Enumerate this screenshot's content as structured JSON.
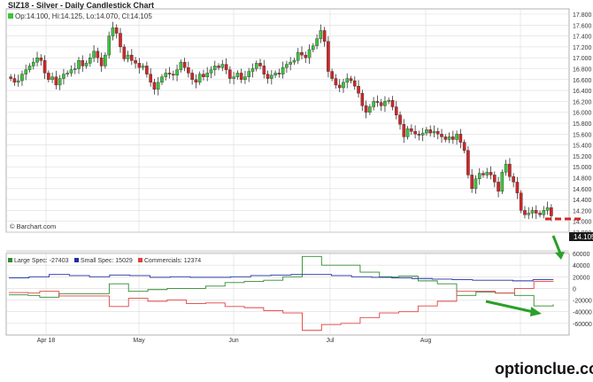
{
  "chart_data": [
    {
      "type": "candlestick",
      "title": "SIZ18 - Silver - Daily Candlestick Chart",
      "ohlc_label": "Op:14.100, Hi:14.125, Lo:14.070, Cl:14.105",
      "source": "© Barchart.com",
      "last_price_label": "14.105",
      "ylim": [
        13.8,
        17.8
      ],
      "y_ticks": [
        "17.800",
        "17.600",
        "17.400",
        "17.200",
        "17.000",
        "16.800",
        "16.600",
        "16.400",
        "16.200",
        "16.000",
        "15.800",
        "15.600",
        "15.400",
        "15.200",
        "15.000",
        "14.800",
        "14.600",
        "14.400",
        "14.200",
        "14.000",
        "13.800"
      ],
      "up_color": "#3cc43c",
      "down_color": "#d42424",
      "closes": [
        16.62,
        16.55,
        16.58,
        16.7,
        16.78,
        16.85,
        16.92,
        17.0,
        16.95,
        16.72,
        16.6,
        16.65,
        16.5,
        16.62,
        16.7,
        16.72,
        16.78,
        16.8,
        16.95,
        16.85,
        16.9,
        17.0,
        17.12,
        17.0,
        16.85,
        17.05,
        17.4,
        17.55,
        17.45,
        17.2,
        16.98,
        17.05,
        16.95,
        16.9,
        16.82,
        16.85,
        16.7,
        16.55,
        16.42,
        16.55,
        16.65,
        16.72,
        16.7,
        16.68,
        16.78,
        16.92,
        16.82,
        16.72,
        16.6,
        16.55,
        16.7,
        16.65,
        16.72,
        16.78,
        16.85,
        16.82,
        16.88,
        16.78,
        16.62,
        16.65,
        16.72,
        16.6,
        16.65,
        16.75,
        16.8,
        16.9,
        16.85,
        16.7,
        16.62,
        16.68,
        16.72,
        16.7,
        16.82,
        16.88,
        16.92,
        16.95,
        17.1,
        17.05,
        17.0,
        17.15,
        17.22,
        17.35,
        17.5,
        17.3,
        16.75,
        16.62,
        16.5,
        16.45,
        16.55,
        16.62,
        16.58,
        16.48,
        16.35,
        16.12,
        16.0,
        16.1,
        16.2,
        16.18,
        16.12,
        16.2,
        16.22,
        16.1,
        15.95,
        15.78,
        15.55,
        15.7,
        15.65,
        15.6,
        15.58,
        15.62,
        15.68,
        15.62,
        15.65,
        15.6,
        15.55,
        15.5,
        15.55,
        15.5,
        15.6,
        15.45,
        15.3,
        14.85,
        14.6,
        14.78,
        14.88,
        14.85,
        14.9,
        14.85,
        14.72,
        14.55,
        14.9,
        15.05,
        14.82,
        14.72,
        14.52,
        14.2,
        14.12,
        14.15,
        14.2,
        14.15,
        14.12,
        14.2,
        14.25,
        14.1
      ],
      "month_labels": [
        "Apr 18",
        "May",
        "Jun",
        "Jul",
        "Aug"
      ],
      "first_close": 16.65
    },
    {
      "type": "line",
      "title": "COT positions",
      "ylim": [
        -80000,
        60000
      ],
      "y_ticks": [
        "60000",
        "40000",
        "20000",
        "0",
        "-20000",
        "-40000",
        "-60000"
      ],
      "series": [
        {
          "name": "Large Spec: -27403",
          "color": "#2e8b2e",
          "values": [
            -11000,
            -11000,
            -11000,
            -11000,
            -11000,
            -12000,
            -12000,
            -12000,
            -15000,
            -15000,
            -15000,
            -15000,
            -15000,
            -9000,
            -9000,
            -9000,
            -9000,
            -9000,
            -9000,
            -9000,
            -9000,
            -9000,
            -9000,
            -9000,
            -9000,
            -9000,
            8000,
            8000,
            8000,
            8000,
            8000,
            -5000,
            -5000,
            -5000,
            -5000,
            -5000,
            -2000,
            -2000,
            -2000,
            -2000,
            -2000,
            0,
            0,
            0,
            0,
            0,
            0,
            0,
            0,
            0,
            0,
            4000,
            4000,
            4000,
            4000,
            4000,
            10000,
            10000,
            10000,
            10000,
            10000,
            12000,
            12000,
            12000,
            12000,
            12000,
            14000,
            14000,
            14000,
            14000,
            14000,
            20000,
            20000,
            20000,
            20000,
            20000,
            55000,
            55000,
            55000,
            55000,
            55000,
            40000,
            40000,
            40000,
            40000,
            40000,
            40000,
            40000,
            40000,
            40000,
            40000,
            28000,
            28000,
            28000,
            28000,
            28000,
            20000,
            20000,
            20000,
            20000,
            20000,
            21000,
            21000,
            21000,
            21000,
            21000,
            13000,
            13000,
            13000,
            13000,
            13000,
            8000,
            8000,
            8000,
            8000,
            8000,
            -12000,
            -12000,
            -12000,
            -12000,
            -12000,
            -6000,
            -6000,
            -6000,
            -6000,
            -6000,
            -8000,
            -8000,
            -8000,
            -8000,
            -8000,
            -12000,
            -12000,
            -12000,
            -12000,
            -12000,
            -30000,
            -30000,
            -30000,
            -30000,
            -30000,
            -27403
          ]
        },
        {
          "name": "Small Spec: 15029",
          "color": "#1f2f9f",
          "values": [
            18000,
            18000,
            18000,
            18000,
            18000,
            20000,
            20000,
            20000,
            20000,
            20000,
            24000,
            24000,
            24000,
            24000,
            24000,
            22000,
            22000,
            22000,
            22000,
            22000,
            20000,
            20000,
            20000,
            20000,
            20000,
            23000,
            23000,
            23000,
            23000,
            23000,
            22000,
            22000,
            22000,
            22000,
            22000,
            19000,
            19000,
            19000,
            19000,
            19000,
            20000,
            20000,
            20000,
            20000,
            20000,
            19000,
            19000,
            19000,
            19000,
            19000,
            19000,
            19000,
            19000,
            19000,
            19000,
            20000,
            20000,
            20000,
            20000,
            20000,
            22000,
            22000,
            22000,
            22000,
            22000,
            23000,
            23000,
            23000,
            23000,
            23000,
            24000,
            24000,
            24000,
            24000,
            24000,
            24000,
            24000,
            24000,
            24000,
            24000,
            22000,
            22000,
            22000,
            22000,
            22000,
            20000,
            20000,
            20000,
            20000,
            20000,
            19000,
            19000,
            19000,
            19000,
            19000,
            18000,
            18000,
            18000,
            18000,
            18000,
            17000,
            17000,
            17000,
            17000,
            17000,
            16000,
            16000,
            16000,
            16000,
            16000,
            15000,
            15000,
            15000,
            15000,
            15000,
            14000,
            14000,
            14000,
            14000,
            14000,
            14000,
            14000,
            14000,
            14000,
            14000,
            13000,
            13000,
            13000,
            13000,
            13000,
            15000,
            15000,
            15000,
            15000,
            15000,
            15029
          ]
        },
        {
          "name": "Commercials: 12374",
          "color": "#e04040",
          "values": [
            -7000,
            -7000,
            -7000,
            -7000,
            -7000,
            -8000,
            -8000,
            -8000,
            -5000,
            -5000,
            -5000,
            -5000,
            -5000,
            -13000,
            -13000,
            -13000,
            -13000,
            -13000,
            -13000,
            -13000,
            -13000,
            -13000,
            -13000,
            -13000,
            -13000,
            -13000,
            -31000,
            -31000,
            -31000,
            -31000,
            -31000,
            -17000,
            -17000,
            -17000,
            -17000,
            -17000,
            -22000,
            -22000,
            -22000,
            -22000,
            -22000,
            -20000,
            -20000,
            -20000,
            -20000,
            -20000,
            -26000,
            -26000,
            -26000,
            -26000,
            -26000,
            -25000,
            -25000,
            -25000,
            -25000,
            -25000,
            -31000,
            -31000,
            -31000,
            -31000,
            -31000,
            -33000,
            -33000,
            -33000,
            -33000,
            -33000,
            -38000,
            -38000,
            -38000,
            -38000,
            -38000,
            -42000,
            -42000,
            -42000,
            -42000,
            -42000,
            -72000,
            -72000,
            -72000,
            -72000,
            -72000,
            -62000,
            -62000,
            -62000,
            -62000,
            -62000,
            -60000,
            -60000,
            -60000,
            -60000,
            -60000,
            -50000,
            -50000,
            -50000,
            -50000,
            -50000,
            -42000,
            -42000,
            -42000,
            -42000,
            -42000,
            -40000,
            -40000,
            -40000,
            -40000,
            -40000,
            -30000,
            -30000,
            -30000,
            -30000,
            -30000,
            -22000,
            -22000,
            -22000,
            -22000,
            -22000,
            -5000,
            -5000,
            -5000,
            -5000,
            -5000,
            -5000,
            -5000,
            -5000,
            -5000,
            -5000,
            -8000,
            -8000,
            -8000,
            -8000,
            -8000,
            0,
            0,
            0,
            0,
            0,
            12000,
            12000,
            12000,
            12000,
            12000,
            12374
          ]
        }
      ]
    }
  ],
  "watermark": "optionclue.com",
  "colors": {
    "resistance": "#d42424",
    "arrow": "#2aa02a",
    "grid": "#dcdcdc"
  }
}
